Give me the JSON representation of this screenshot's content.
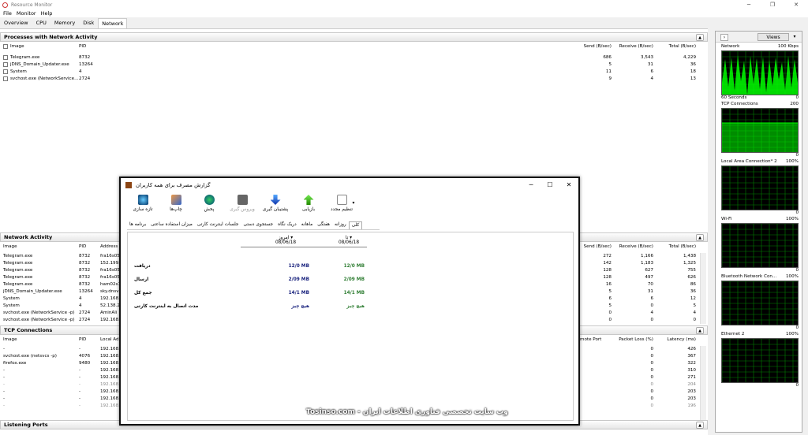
{
  "window": {
    "title": "Resource Monitor",
    "minimize": "─",
    "maximize": "❐",
    "close": "✕"
  },
  "menu": [
    "File",
    "Monitor",
    "Help"
  ],
  "tabs": [
    "Overview",
    "CPU",
    "Memory",
    "Disk",
    "Network"
  ],
  "processes": {
    "title": "Processes with Network Activity",
    "headers": {
      "image": "Image",
      "pid": "PID",
      "send": "Send (B/sec)",
      "receive": "Receive (B/sec)",
      "total": "Total (B/sec)"
    },
    "rows": [
      {
        "image": "Telegram.exe",
        "pid": "8732",
        "send": "686",
        "receive": "3,543",
        "total": "4,229"
      },
      {
        "image": "jDNS_Domain_Updater.exe",
        "pid": "13264",
        "send": "5",
        "receive": "31",
        "total": "36"
      },
      {
        "image": "System",
        "pid": "4",
        "send": "11",
        "receive": "6",
        "total": "18"
      },
      {
        "image": "svchost.exe (NetworkService...",
        "pid": "2724",
        "send": "9",
        "receive": "4",
        "total": "13"
      }
    ]
  },
  "activity": {
    "title": "Network Activity",
    "headers": {
      "image": "Image",
      "pid": "PID",
      "address": "Address",
      "send": "Send (B/sec)",
      "receive": "Receive (B/sec)",
      "total": "Total (B/sec)"
    },
    "rows": [
      {
        "image": "Telegram.exe",
        "pid": "8732",
        "address": "fra16s05",
        "send": "272",
        "receive": "1,166",
        "total": "1,438"
      },
      {
        "image": "Telegram.exe",
        "pid": "8732",
        "address": "152.199.",
        "send": "142",
        "receive": "1,183",
        "total": "1,325"
      },
      {
        "image": "Telegram.exe",
        "pid": "8732",
        "address": "fra16s05",
        "send": "128",
        "receive": "627",
        "total": "755"
      },
      {
        "image": "Telegram.exe",
        "pid": "8732",
        "address": "fra16s05",
        "send": "128",
        "receive": "497",
        "total": "626"
      },
      {
        "image": "Telegram.exe",
        "pid": "8732",
        "address": "ham02s1",
        "send": "16",
        "receive": "70",
        "total": "86"
      },
      {
        "image": "jDNS_Domain_Updater.exe",
        "pid": "13264",
        "address": "sky.dnsv",
        "send": "5",
        "receive": "31",
        "total": "36"
      },
      {
        "image": "System",
        "pid": "4",
        "address": "192.168.",
        "send": "6",
        "receive": "6",
        "total": "12"
      },
      {
        "image": "System",
        "pid": "4",
        "address": "52.138.2",
        "send": "5",
        "receive": "0",
        "total": "5"
      },
      {
        "image": "svchost.exe (NetworkService -p)",
        "pid": "2724",
        "address": "AminAli",
        "send": "0",
        "receive": "4",
        "total": "4"
      },
      {
        "image": "svchost.exe (NetworkService -p)",
        "pid": "2724",
        "address": "192.168.",
        "send": "0",
        "receive": "0",
        "total": "0"
      }
    ]
  },
  "tcp": {
    "title": "TCP Connections",
    "headers": {
      "image": "Image",
      "pid": "PID",
      "local": "Local Ad",
      "remote_port": "mote Port",
      "loss": "Packet Loss (%)",
      "latency": "Latency (ms)"
    },
    "rows": [
      {
        "image": "-",
        "pid": "-",
        "local": "192.168.",
        "loss": "0",
        "latency": "426"
      },
      {
        "image": "svchost.exe (netsvcs -p)",
        "pid": "4076",
        "local": "192.168.",
        "loss": "0",
        "latency": "367"
      },
      {
        "image": "firefox.exe",
        "pid": "9480",
        "local": "192.168.",
        "loss": "0",
        "latency": "322"
      },
      {
        "image": "-",
        "pid": "-",
        "local": "192.168.",
        "loss": "0",
        "latency": "310"
      },
      {
        "image": "-",
        "pid": "-",
        "local": "192.168.",
        "loss": "0",
        "latency": "271"
      },
      {
        "image": "-",
        "pid": "-",
        "local": "192.168.",
        "loss": "0",
        "latency": "204"
      },
      {
        "image": "-",
        "pid": "-",
        "local": "192.168.",
        "loss": "0",
        "latency": "203"
      },
      {
        "image": "-",
        "pid": "-",
        "local": "192.168.",
        "loss": "0",
        "latency": "203"
      },
      {
        "image": "-",
        "pid": "-",
        "local": "192.168.",
        "loss": "0",
        "latency": "196"
      }
    ]
  },
  "listening": {
    "title": "Listening Ports"
  },
  "right_panel": {
    "views_label": "Views",
    "graphs": [
      {
        "name": "Network",
        "max": "100 Kbps",
        "foot_left": "60 Seconds",
        "foot_right": "0"
      },
      {
        "name": "TCP Connections",
        "max": "200",
        "foot_left": "",
        "foot_right": "0"
      },
      {
        "name": "Local Area Connection* 2",
        "max": "100%",
        "foot_left": "",
        "foot_right": "0"
      },
      {
        "name": "Wi-Fi",
        "max": "100%",
        "foot_left": "",
        "foot_right": "0"
      },
      {
        "name": "Bluetooth Network Con...",
        "max": "100%",
        "foot_left": "",
        "foot_right": "0"
      },
      {
        "name": "Ethernet 2",
        "max": "100%",
        "foot_left": "",
        "foot_right": "0"
      }
    ],
    "grid_color": "#008000",
    "line_color": "#00ff00"
  },
  "dialog": {
    "title": "گزارش مصرف برای همه کاربران",
    "toolbar": [
      "تنظیم مجدد",
      "بازیابی",
      "پشتیبان گیری",
      "ویروس گیری",
      "پخش",
      "چاپ‌ها",
      "تازه سازی"
    ],
    "tabs": [
      "کلی",
      "روزانه",
      "هفتگی",
      "ماهانه",
      "دریک نگاه",
      "جستجوی دستی",
      "جلسات اینترنت کارتی",
      "میزان استفاده ساعتی",
      "برنامه ها"
    ],
    "col_today": {
      "label": "امروز",
      "date": "08/06/18"
    },
    "col_until": {
      "label": "تا",
      "date": "08/06/18"
    },
    "rows": [
      {
        "label": "دریافت",
        "today": "12/0 MB",
        "until": "12/0 MB"
      },
      {
        "label": "ارسال",
        "today": "2/09 MB",
        "until": "2/09 MB"
      },
      {
        "label": "جمع کل",
        "today": "14/1 MB",
        "until": "14/1 MB"
      },
      {
        "label": "مدت اتصال به اینترنت کارتی",
        "today": "هیچ چیز",
        "until": "هیچ چیز"
      }
    ],
    "today_color": "#1a237e",
    "until_color": "#2e7d32"
  },
  "watermark": "Tosinso.com - وب سایت تخصصی فناوری اطلاعات ایران"
}
